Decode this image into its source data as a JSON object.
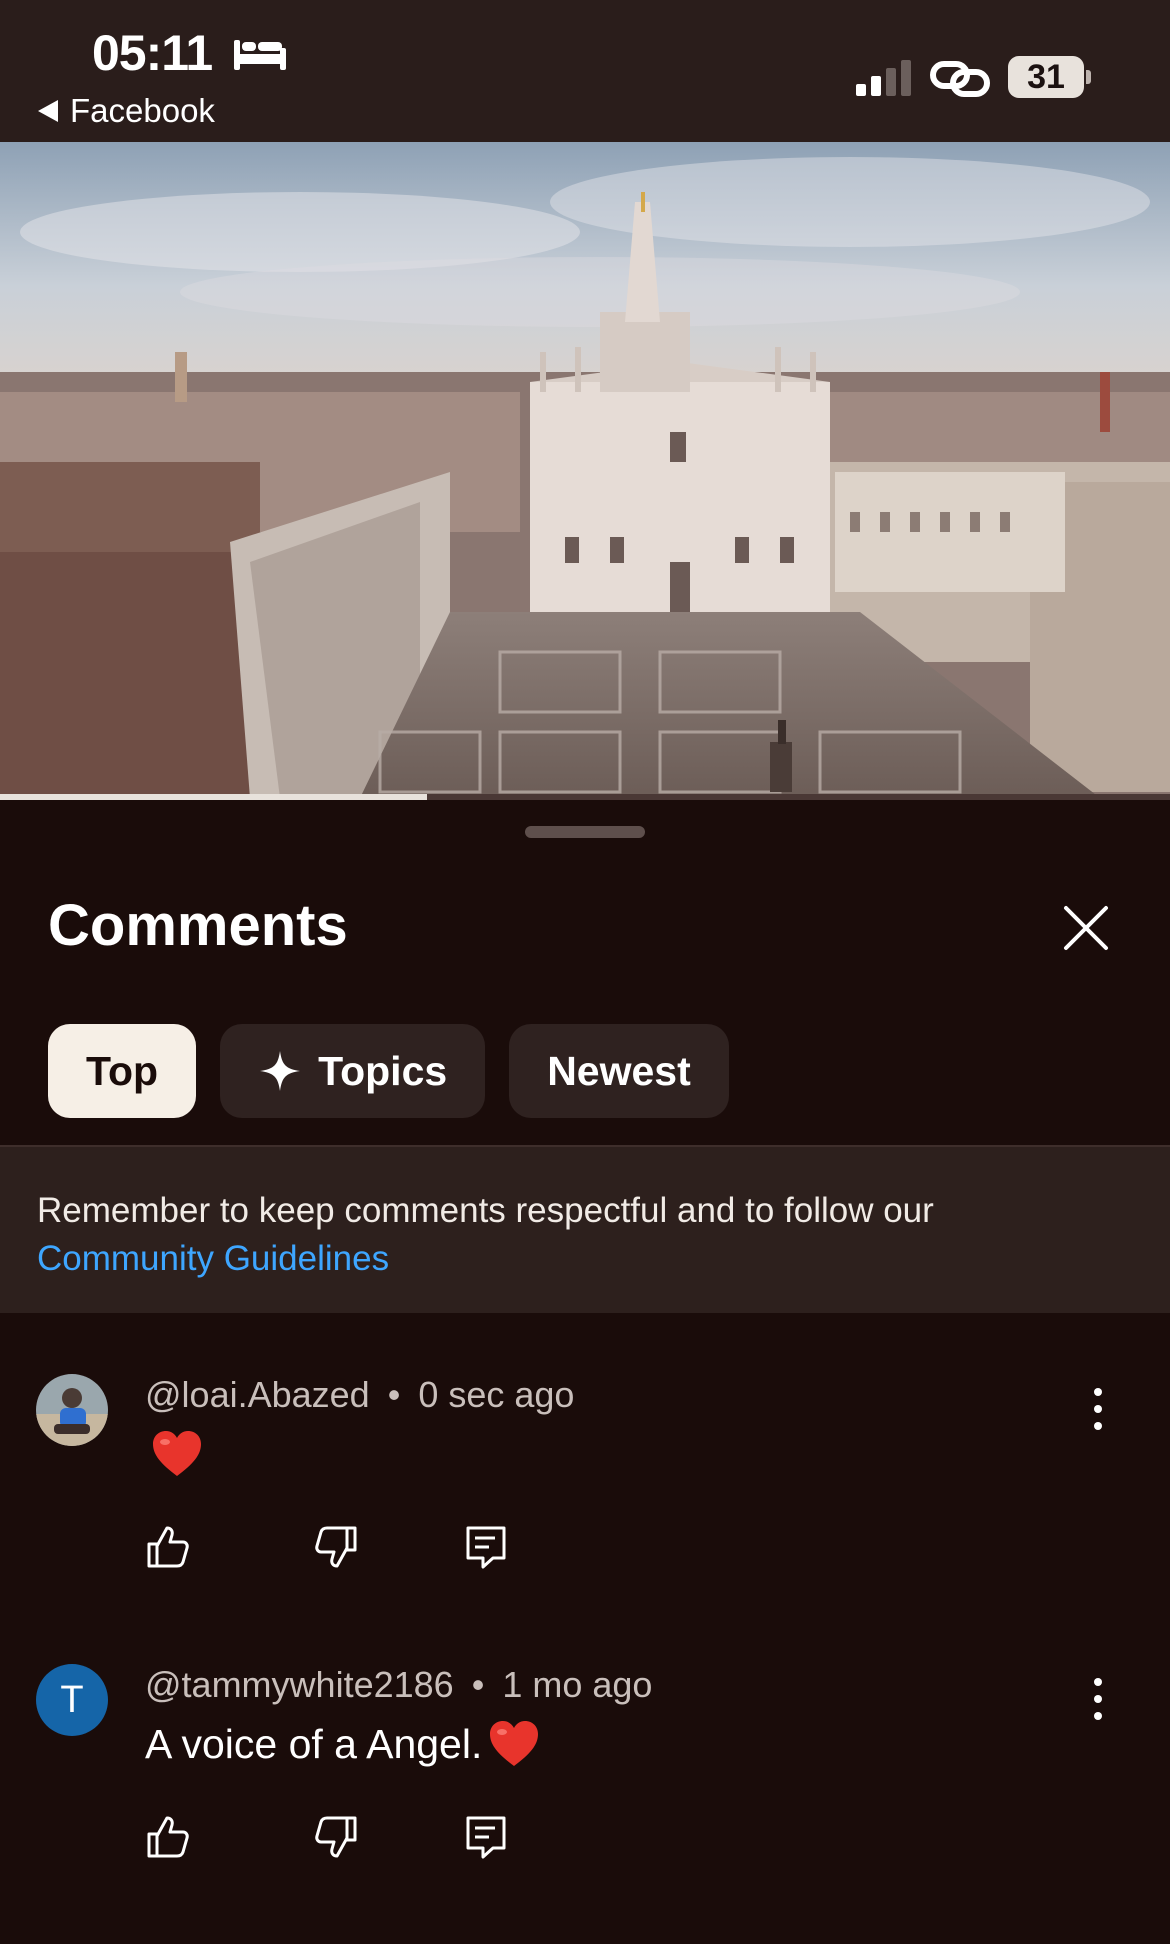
{
  "status_bar": {
    "time": "05:11",
    "back_app": "Facebook",
    "battery": "31"
  },
  "video": {
    "progress": 0.365
  },
  "sheet": {
    "title": "Comments",
    "chips": [
      {
        "label": "Top",
        "active": true
      },
      {
        "label": "Topics",
        "active": false
      },
      {
        "label": "Newest",
        "active": false
      }
    ],
    "notice": {
      "text": "Remember to keep comments respectful and to follow our",
      "link": "Community Guidelines"
    }
  },
  "comments": [
    {
      "author": "@loai.Abazed",
      "sep": "•",
      "time": "0 sec ago",
      "text": ""
    },
    {
      "author": "@tammywhite2186",
      "sep": "•",
      "time": "1 mo ago",
      "text": "A voice of a Angel.",
      "avatar_letter": "T"
    }
  ],
  "colors": {
    "background": "#1a0c0a",
    "link": "#3ea6ff",
    "chip_active": "#f6efe6",
    "chip": "#2f2220",
    "avatar_t": "#1565a8"
  }
}
